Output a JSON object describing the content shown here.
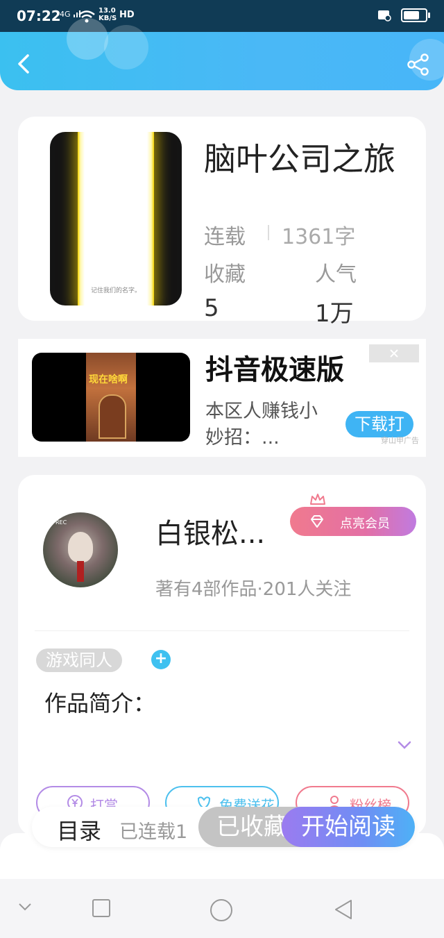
{
  "status_bar": {
    "time": "07:22",
    "network": "4G",
    "speed_value": "13.0",
    "speed_unit": "KB/S",
    "hd": "HD"
  },
  "header": {
    "back_icon": "chevron-left-icon",
    "share_icon": "share-icon",
    "accent_start": "#3bc0f0",
    "accent_end": "#47b6f8"
  },
  "book": {
    "title": "脑叶公司之旅",
    "cover_caption": "记住我们的名字。",
    "status_label": "连载",
    "word_count": "1361字",
    "favorites_label": "收藏",
    "favorites_value": "5",
    "popularity_label": "人气",
    "popularity_value": "1万"
  },
  "ad": {
    "thumb_title": "现在啥啊",
    "title": "抖音极速版",
    "description": "本区人赚钱小妙招：...",
    "download_label": "下载打",
    "source_tag": "穿山甲广告"
  },
  "author": {
    "name": "白银松...",
    "avatar_rec": "REC",
    "vip_label": "点亮会员",
    "subtitle": "著有4部作品·201人关注",
    "tag": "游戏同人",
    "add_tag": "+",
    "intro_label": "作品简介：",
    "actions": [
      {
        "label": "打赏",
        "icon": "yen-icon",
        "color": "#b38be6"
      },
      {
        "label": "免费送花",
        "icon": "flower-icon",
        "color": "#4cc0ee"
      },
      {
        "label": "粉丝榜",
        "icon": "person-icon",
        "color": "#f07a8e"
      }
    ]
  },
  "bottom_bar": {
    "toc_label": "目录",
    "serial_label": "已连载1",
    "collect_label": "已收藏",
    "read_label": "开始阅读"
  },
  "nav": {
    "icons": [
      "chevron-down-icon",
      "square-icon",
      "circle-icon",
      "triangle-back-icon"
    ]
  }
}
